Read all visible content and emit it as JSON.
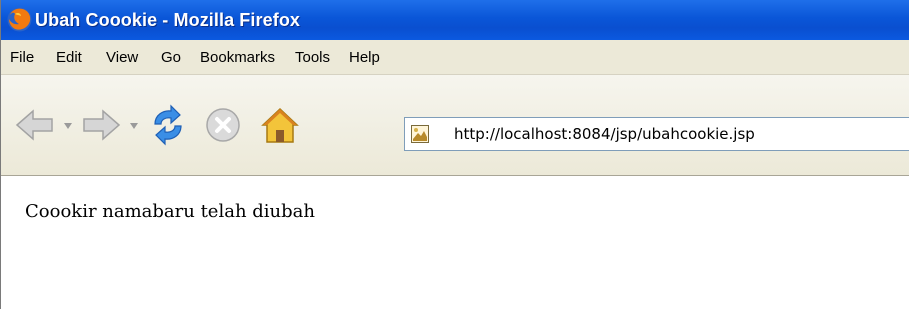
{
  "window": {
    "title": "Ubah Coookie - Mozilla Firefox"
  },
  "menu": {
    "items": [
      {
        "label": "File"
      },
      {
        "label": "Edit"
      },
      {
        "label": "View"
      },
      {
        "label": "Go"
      },
      {
        "label": "Bookmarks"
      },
      {
        "label": "Tools"
      },
      {
        "label": "Help"
      }
    ]
  },
  "toolbar": {
    "icons": [
      "back-arrow-icon",
      "forward-arrow-icon",
      "reload-icon",
      "stop-icon",
      "home-icon"
    ]
  },
  "address": {
    "url": "http://localhost:8084/jsp/ubahcookie.jsp",
    "favicon": "page-favicon-icon"
  },
  "content": {
    "message": "Coookir namabaru telah diubah"
  },
  "colors": {
    "titlebar": "#0a56d8",
    "chrome": "#ece9d8",
    "url_border": "#7f9db9"
  }
}
